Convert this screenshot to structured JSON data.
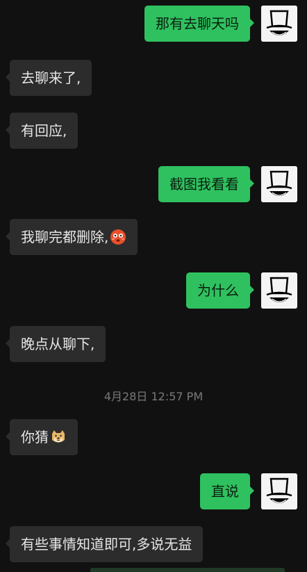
{
  "messages": [
    {
      "side": "out",
      "text": "那有去聊天吗"
    },
    {
      "side": "in",
      "text": "去聊来了,"
    },
    {
      "side": "in",
      "text": "有回应,"
    },
    {
      "side": "out",
      "text": "截图我看看"
    },
    {
      "side": "in",
      "text": "我聊完都删除,",
      "emoji": "flushed-face-icon"
    },
    {
      "side": "out",
      "text": "为什么"
    },
    {
      "side": "in",
      "text": "晚点从聊下,"
    },
    {
      "side": "in",
      "text": "你猜",
      "emoji": "doge-icon"
    },
    {
      "side": "out",
      "text": "直说"
    },
    {
      "side": "in",
      "text": "有些事情知道即可,多说无益"
    }
  ],
  "timestamp": "4月28日 12:57 PM",
  "colors": {
    "background": "#111111",
    "incoming_bubble": "#2c2c2c",
    "outgoing_bubble": "#2fc15f"
  },
  "avatar_icon": "top-hat-avatar-icon"
}
